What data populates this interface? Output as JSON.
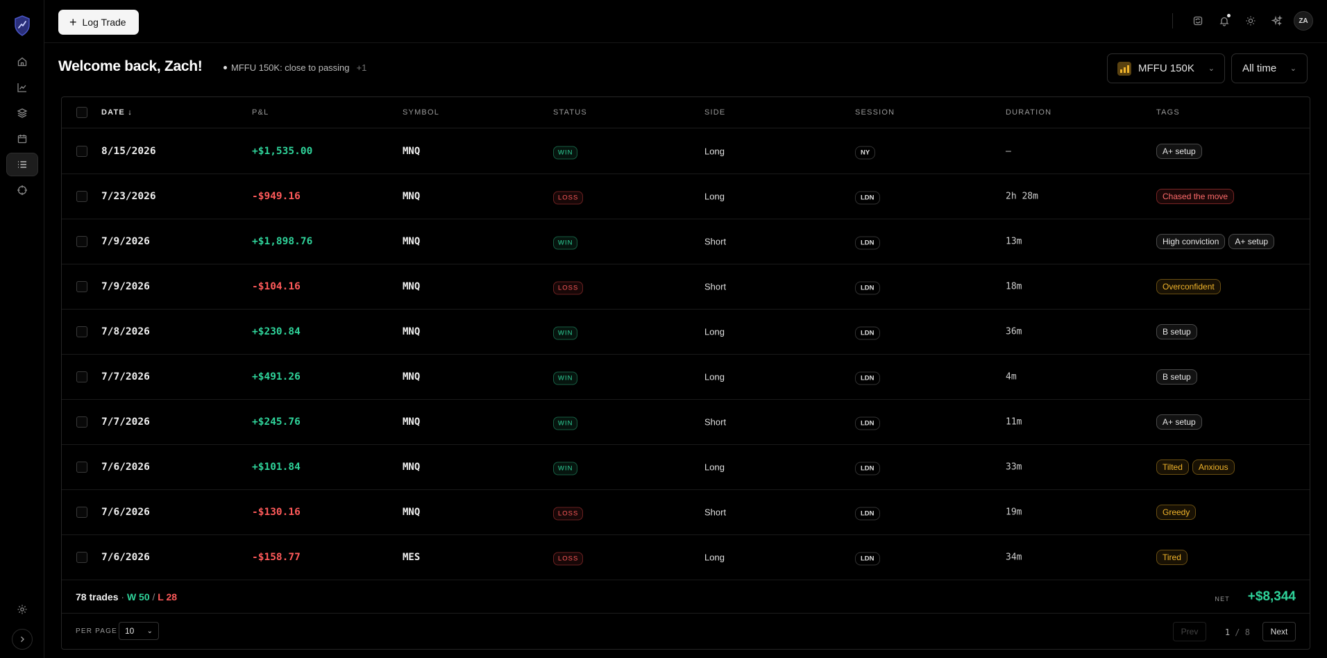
{
  "header": {
    "log_trade_label": "Log Trade",
    "avatar_initials": "ZA"
  },
  "welcome": {
    "title": "Welcome back, Zach!",
    "status_text": "MFFU 150K: close to passing",
    "status_more": "+1"
  },
  "filters": {
    "account": "MFFU 150K",
    "range": "All time"
  },
  "table": {
    "columns": [
      "Date",
      "P&L",
      "Symbol",
      "Status",
      "Side",
      "Session",
      "Duration",
      "Tags"
    ],
    "sort_indicator": "↓",
    "rows": [
      {
        "date": "8/15/2026",
        "pnl": "+$1,535.00",
        "symbol": "MNQ",
        "status": "WIN",
        "side": "Long",
        "session": "NY",
        "duration": "—",
        "tags": [
          {
            "label": "A+ setup",
            "tone": "neutral"
          }
        ]
      },
      {
        "date": "7/23/2026",
        "pnl": "-$949.16",
        "symbol": "MNQ",
        "status": "LOSS",
        "side": "Long",
        "session": "LDN",
        "duration": "2h 28m",
        "tags": [
          {
            "label": "Chased the move",
            "tone": "red"
          }
        ]
      },
      {
        "date": "7/9/2026",
        "pnl": "+$1,898.76",
        "symbol": "MNQ",
        "status": "WIN",
        "side": "Short",
        "session": "LDN",
        "duration": "13m",
        "tags": [
          {
            "label": "High conviction",
            "tone": "neutral"
          },
          {
            "label": "A+ setup",
            "tone": "neutral"
          }
        ]
      },
      {
        "date": "7/9/2026",
        "pnl": "-$104.16",
        "symbol": "MNQ",
        "status": "LOSS",
        "side": "Short",
        "session": "LDN",
        "duration": "18m",
        "tags": [
          {
            "label": "Overconfident",
            "tone": "amber"
          }
        ]
      },
      {
        "date": "7/8/2026",
        "pnl": "+$230.84",
        "symbol": "MNQ",
        "status": "WIN",
        "side": "Long",
        "session": "LDN",
        "duration": "36m",
        "tags": [
          {
            "label": "B setup",
            "tone": "neutral"
          }
        ]
      },
      {
        "date": "7/7/2026",
        "pnl": "+$491.26",
        "symbol": "MNQ",
        "status": "WIN",
        "side": "Long",
        "session": "LDN",
        "duration": "4m",
        "tags": [
          {
            "label": "B setup",
            "tone": "neutral"
          }
        ]
      },
      {
        "date": "7/7/2026",
        "pnl": "+$245.76",
        "symbol": "MNQ",
        "status": "WIN",
        "side": "Short",
        "session": "LDN",
        "duration": "11m",
        "tags": [
          {
            "label": "A+ setup",
            "tone": "neutral"
          }
        ]
      },
      {
        "date": "7/6/2026",
        "pnl": "+$101.84",
        "symbol": "MNQ",
        "status": "WIN",
        "side": "Long",
        "session": "LDN",
        "duration": "33m",
        "tags": [
          {
            "label": "Tilted",
            "tone": "amber"
          },
          {
            "label": "Anxious",
            "tone": "amber"
          }
        ]
      },
      {
        "date": "7/6/2026",
        "pnl": "-$130.16",
        "symbol": "MNQ",
        "status": "LOSS",
        "side": "Short",
        "session": "LDN",
        "duration": "19m",
        "tags": [
          {
            "label": "Greedy",
            "tone": "amber"
          }
        ]
      },
      {
        "date": "7/6/2026",
        "pnl": "-$158.77",
        "symbol": "MES",
        "status": "LOSS",
        "side": "Long",
        "session": "LDN",
        "duration": "34m",
        "tags": [
          {
            "label": "Tired",
            "tone": "amber"
          }
        ]
      }
    ]
  },
  "summary": {
    "trades": "78 trades",
    "dot": "·",
    "wins": "W 50",
    "slash": "/",
    "losses": "L 28",
    "net_label": "NET",
    "net_value": "+$8,344"
  },
  "pagination": {
    "per_page_label": "PER PAGE",
    "per_page_value": "10",
    "prev_label": "Prev",
    "current_page": "1",
    "separator": "/",
    "total_pages": "8",
    "next_label": "Next"
  },
  "colors": {
    "positive": "#2fd39a",
    "negative": "#ff5a5a",
    "amber": "#f2b52b",
    "background": "#000000"
  },
  "icons": [
    "shield-logo-icon",
    "home-icon",
    "chart-line-icon",
    "layers-icon",
    "calendar-icon",
    "list-icon",
    "crosshair-icon",
    "settings-icon",
    "chevron-right-icon",
    "refresh-icon",
    "bell-icon",
    "sun-icon",
    "sparkles-icon",
    "plus-icon",
    "chevron-down-icon",
    "arrow-down-icon"
  ]
}
